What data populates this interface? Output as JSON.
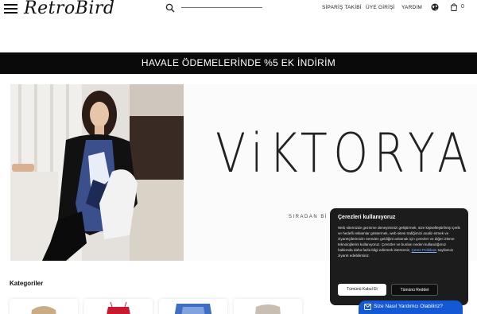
{
  "header": {
    "logo": "RetroBird",
    "search_placeholder": "",
    "nav": {
      "order_tracking": "SİPARİŞ TAKİBİ",
      "login": "ÜYE GİRİŞİ",
      "help": "YARDIM"
    },
    "cart_count": "0",
    "icons": [
      "hamburger-icon",
      "search-icon",
      "globe-icon",
      "cart-icon"
    ]
  },
  "promo": {
    "text": "HAVALE ÖDEMELERİNDE %5 EK İNDİRİM"
  },
  "hero": {
    "brand": "ViKTORYA",
    "subtitle": "SIRADAN Bİ"
  },
  "categories": {
    "title": "Kategoriler"
  },
  "cookie": {
    "title": "Çerezleri kullanıyoruz",
    "body": "Web sitemizde gezinme deneyiminizi geliştirmek, size kişiselleştirilmiş içerik ve hedefli reklamlar göstermek, web sitesi trafiğimizi analiz etmek ve ziyaretçilerimizin nereden geldiğini anlamak için çerezler ve diğer izleme teknolojilerini kullanıyoruz. Çerezler ve bunları neden kullandığımız hakkında daha fazla bilgi edinmek isterseniz,",
    "link": "Çerez Politikası",
    "body_end": "sayfamızı ziyaret edebilirsiniz.",
    "accept": "Tümünü Kabul Et",
    "reject": "Tümünü Reddet"
  },
  "help_chat": {
    "label": "Size Nasıl Yardımcı Olabiliriz?"
  },
  "colors": {
    "promo_bg": "#0a0a0a",
    "cookie_bg": "#1c1c1c",
    "chat_bg": "#1458d6",
    "link": "#7fb2ff"
  }
}
